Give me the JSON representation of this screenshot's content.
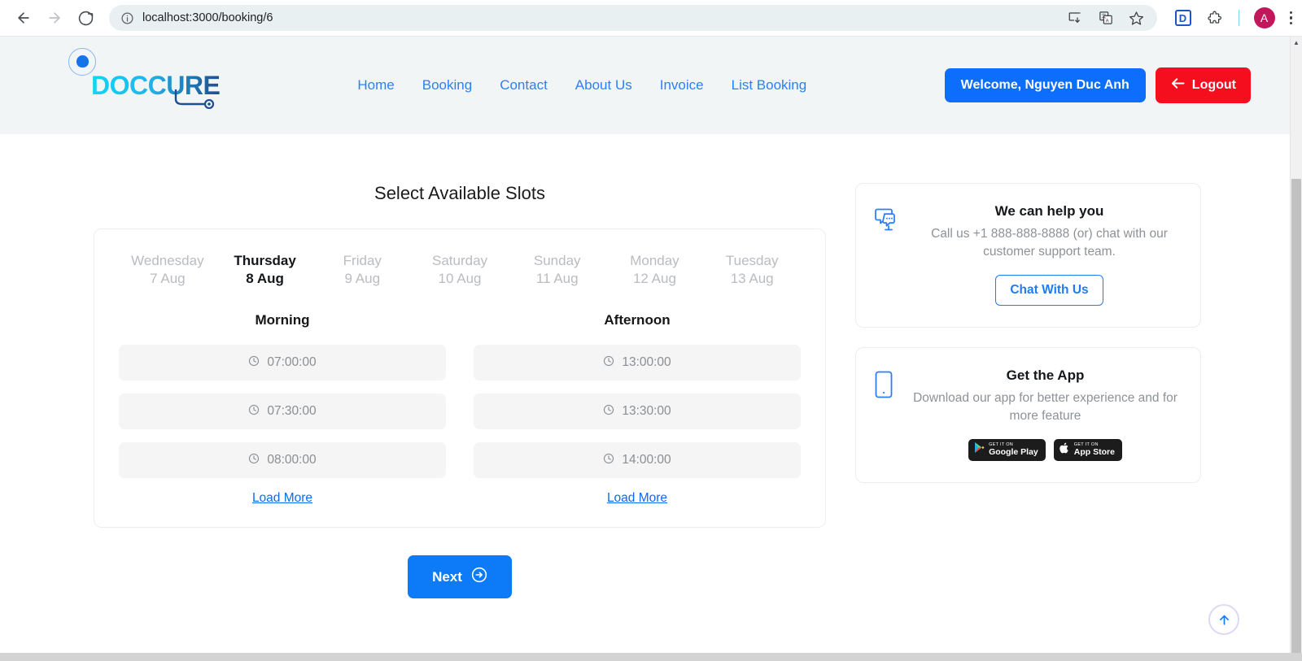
{
  "browser": {
    "back_label": "Back",
    "forward_label": "Forward",
    "reload_label": "Reload",
    "site_info_label": "View site information",
    "url": "localhost:3000/booking/6",
    "install_label": "Install",
    "translate_label": "Translate this page",
    "bookmark_label": "Bookmark this tab",
    "extension_badge": "D",
    "extensions_label": "Extensions",
    "profile_initial": "A",
    "menu_label": "Customize and control Google Chrome"
  },
  "site_header": {
    "logo_text": "DOCCURE",
    "nav": [
      {
        "label": "Home"
      },
      {
        "label": "Booking"
      },
      {
        "label": "Contact"
      },
      {
        "label": "About Us"
      },
      {
        "label": "Invoice"
      },
      {
        "label": "List Booking"
      }
    ],
    "welcome_label": "Welcome, Nguyen Duc Anh",
    "logout_label": "Logout"
  },
  "booking": {
    "title": "Select Available Slots",
    "days": [
      {
        "dow": "Wednesday",
        "dom": "7 Aug",
        "active": false
      },
      {
        "dow": "Thursday",
        "dom": "8 Aug",
        "active": true
      },
      {
        "dow": "Friday",
        "dom": "9 Aug",
        "active": false
      },
      {
        "dow": "Saturday",
        "dom": "10 Aug",
        "active": false
      },
      {
        "dow": "Sunday",
        "dom": "11 Aug",
        "active": false
      },
      {
        "dow": "Monday",
        "dom": "12 Aug",
        "active": false
      },
      {
        "dow": "Tuesday",
        "dom": "13 Aug",
        "active": false
      }
    ],
    "morning": {
      "heading": "Morning",
      "slots": [
        "07:00:00",
        "07:30:00",
        "08:00:00"
      ],
      "load_more": "Load More"
    },
    "afternoon": {
      "heading": "Afternoon",
      "slots": [
        "13:00:00",
        "13:30:00",
        "14:00:00"
      ],
      "load_more": "Load More"
    },
    "next_label": "Next"
  },
  "help_card": {
    "title": "We can help you",
    "text": "Call us +1 888-888-8888 (or) chat with our customer support team.",
    "button_label": "Chat With Us"
  },
  "app_card": {
    "title": "Get the App",
    "text": "Download our app for better experience and for more feature",
    "google_play": {
      "top": "GET IT ON",
      "name": "Google Play"
    },
    "app_store": {
      "top": "GET IT ON",
      "name": "App Store"
    }
  },
  "scroll_top_label": "Back to top",
  "colors": {
    "primary_blue": "#0d6efd",
    "nav_blue": "#2d7ff9",
    "logout_red": "#f50f1e",
    "header_bg": "#f1f5f6",
    "slot_bg": "#f5f5f5",
    "muted_text": "#8d9297"
  }
}
